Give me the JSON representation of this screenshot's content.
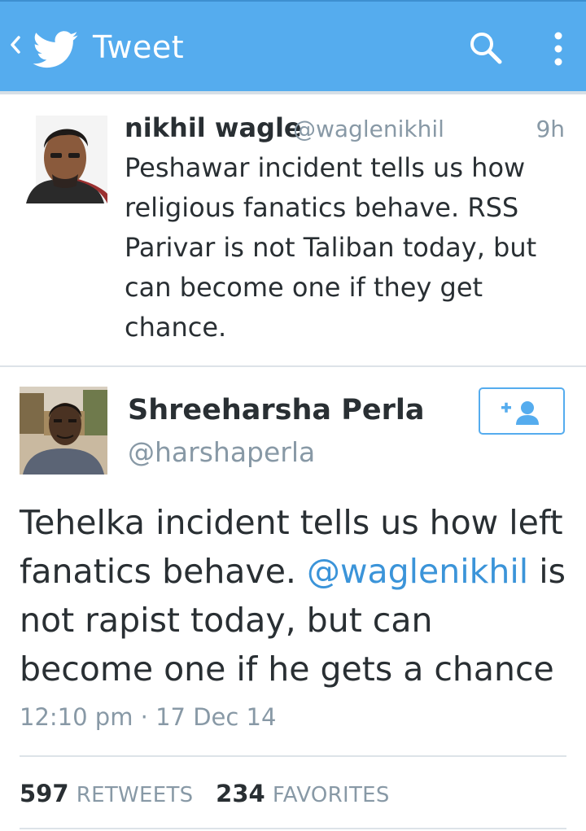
{
  "header": {
    "back_icon": "chevron-left-icon",
    "logo_icon": "twitter-bird-icon",
    "title": "Tweet",
    "search_icon": "search-icon",
    "more_icon": "more-vertical-icon",
    "bar_color": "#55acee"
  },
  "original_tweet": {
    "name": "nikhil wagle",
    "handle": "@waglenikhil",
    "time": "9h",
    "text": "Peshawar incident tells us how religious fanatics behave. RSS Parivar is not Taliban today, but can become one if they get chance."
  },
  "reply_tweet": {
    "name": "Shreeharsha Perla",
    "handle": "@harshaperla",
    "follow_icon": "add-user-icon",
    "text_before": "Tehelka incident tells us how left fanatics behave. ",
    "mention": "@waglenikhil",
    "text_after": " is not rapist today, but can become one if he gets a chance",
    "timestamp": "12:10 pm · 17 Dec 14",
    "retweets_count": "597",
    "retweets_label": "RETWEETS",
    "favorites_count": "234",
    "favorites_label": "FAVORITES",
    "accent_color": "#3b94d9"
  }
}
